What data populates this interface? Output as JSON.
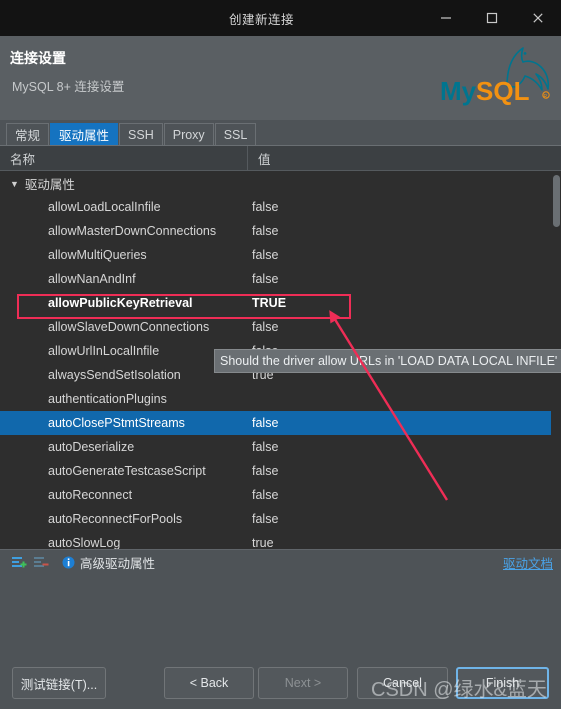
{
  "window": {
    "title": "创建新连接",
    "controls": [
      {
        "name": "minimize",
        "glyph": "minimize-icon"
      },
      {
        "name": "maximize",
        "glyph": "maximize-icon"
      },
      {
        "name": "close",
        "glyph": "close-icon"
      }
    ]
  },
  "header": {
    "title": "连接设置",
    "subtitle": "MySQL 8+ 连接设置",
    "logo_alt": "mysql-logo",
    "logo_text": "MySQL",
    "colors": {
      "logo_teal": "#00758f",
      "logo_orange": "#f29111",
      "header_bg": "#5a5f63"
    }
  },
  "tabs": [
    {
      "label": "常规",
      "active": false
    },
    {
      "label": "驱动属性",
      "active": true
    },
    {
      "label": "SSH",
      "active": false
    },
    {
      "label": "Proxy",
      "active": false
    },
    {
      "label": "SSL",
      "active": false
    }
  ],
  "table": {
    "columns": [
      "名称",
      "值"
    ],
    "group_label": "驱动属性",
    "rows": [
      {
        "name": "allowLoadLocalInfile",
        "value": "false",
        "state": "normal"
      },
      {
        "name": "allowMasterDownConnections",
        "value": "false",
        "state": "normal"
      },
      {
        "name": "allowMultiQueries",
        "value": "false",
        "state": "normal"
      },
      {
        "name": "allowNanAndInf",
        "value": "false",
        "state": "normal"
      },
      {
        "name": "allowPublicKeyRetrieval",
        "value": "TRUE",
        "state": "highlight"
      },
      {
        "name": "allowSlaveDownConnections",
        "value": "false",
        "state": "normal"
      },
      {
        "name": "allowUrlInLocalInfile",
        "value": "false",
        "state": "normal"
      },
      {
        "name": "alwaysSendSetIsolation",
        "value": "true",
        "state": "normal"
      },
      {
        "name": "authenticationPlugins",
        "value": "",
        "state": "normal"
      },
      {
        "name": "autoClosePStmtStreams",
        "value": "false",
        "state": "selected"
      },
      {
        "name": "autoDeserialize",
        "value": "false",
        "state": "normal"
      },
      {
        "name": "autoGenerateTestcaseScript",
        "value": "false",
        "state": "normal"
      },
      {
        "name": "autoReconnect",
        "value": "false",
        "state": "normal"
      },
      {
        "name": "autoReconnectForPools",
        "value": "false",
        "state": "normal"
      },
      {
        "name": "autoSlowLog",
        "value": "true",
        "state": "normal"
      }
    ],
    "selection_color": "#1168ac"
  },
  "tooltip": {
    "text": "Should the driver allow URLs in 'LOAD DATA LOCAL INFILE' sta"
  },
  "toolbar": {
    "add_icon": "add-property-icon",
    "remove_icon": "remove-property-icon",
    "info_icon": "info-icon",
    "advanced_label": "高级驱动属性",
    "doc_link": "驱动文档",
    "link_color": "#4aa3e8"
  },
  "buttons": {
    "test": "测试链接(T)...",
    "back": "< Back",
    "next": "Next >",
    "cancel": "Cancel",
    "finish": "Finish"
  },
  "annotations": {
    "box_color": "#ef2d56",
    "arrow_color": "#ef2d56",
    "watermark": "CSDN @绿水&蓝天"
  }
}
